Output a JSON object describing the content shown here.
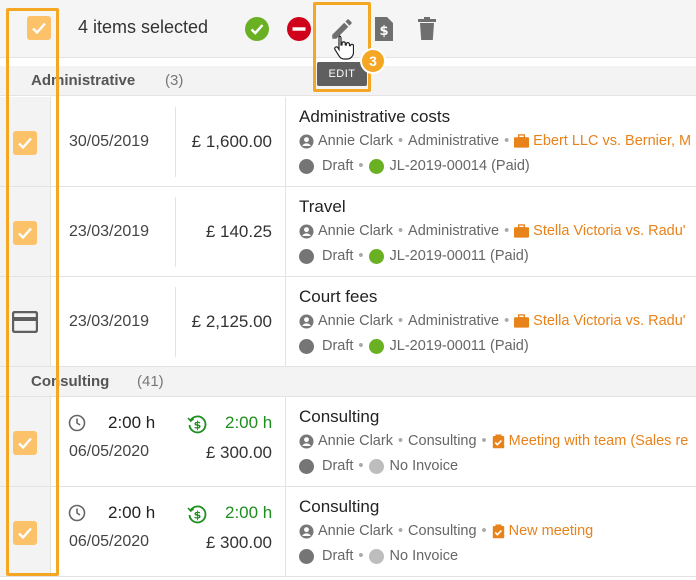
{
  "toolbar": {
    "selected_text": "4 items selected",
    "tooltip": "EDIT",
    "step_badge": "3",
    "icons": [
      "select-all-checkbox",
      "check-circle-icon",
      "minus-circle-icon",
      "pencil-icon",
      "invoice-dollar-icon",
      "trash-icon"
    ]
  },
  "groups": [
    {
      "title": "Administrative",
      "count": "(3)"
    },
    {
      "title": "Consulting",
      "count": "(41)"
    }
  ],
  "rows": [
    {
      "date": "30/05/2019",
      "amount": "£ 1,600.00",
      "title": "Administrative costs",
      "user": "Annie Clark",
      "category": "Administrative",
      "matter": "Ebert LLC vs. Bernier, M",
      "status": "Draft",
      "invoice": "JL-2019-00014 (Paid)",
      "selected": true
    },
    {
      "date": "23/03/2019",
      "amount": "£ 140.25",
      "title": "Travel",
      "user": "Annie Clark",
      "category": "Administrative",
      "matter": "Stella Victoria vs. Radu'",
      "status": "Draft",
      "invoice": "JL-2019-00011 (Paid)",
      "selected": true
    },
    {
      "date": "23/03/2019",
      "amount": "£ 2,125.00",
      "title": "Court fees",
      "user": "Annie Clark",
      "category": "Administrative",
      "matter": "Stella Victoria vs. Radu'",
      "status": "Draft",
      "invoice": "JL-2019-00011 (Paid)",
      "selected": false
    },
    {
      "time": "2:00 h",
      "billable": "2:00 h",
      "date": "06/05/2020",
      "amount": "£ 300.00",
      "title": "Consulting",
      "user": "Annie Clark",
      "category": "Consulting",
      "task": "Meeting with team (Sales re",
      "status": "Draft",
      "invoice": "No Invoice",
      "selected": true
    },
    {
      "time": "2:00 h",
      "billable": "2:00 h",
      "date": "06/05/2020",
      "amount": "£ 300.00",
      "title": "Consulting",
      "user": "Annie Clark",
      "category": "Consulting",
      "task": "New meeting",
      "status": "Draft",
      "invoice": "No Invoice",
      "selected": true
    }
  ],
  "colors": {
    "accent": "#f5a623",
    "checkbox": "#fbc26a",
    "green": "#1e8e1e",
    "paid": "#6ab023",
    "orange": "#e8821a",
    "red": "#d0021b",
    "draft": "#757575",
    "noinvoice": "#bdbdbd"
  }
}
